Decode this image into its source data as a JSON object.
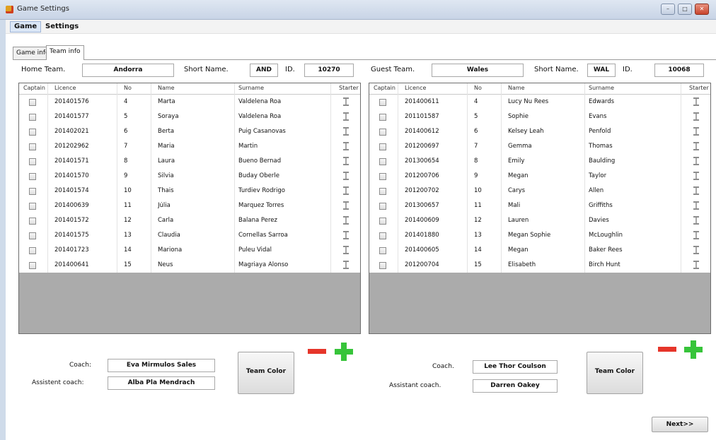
{
  "window": {
    "title": "Game Settings",
    "controls": [
      "minimize-icon",
      "maximize-icon",
      "close-icon"
    ]
  },
  "menu": [
    "Game",
    "Settings"
  ],
  "tabs": [
    "Game info",
    "Team info"
  ],
  "columns": [
    "Captain",
    "Licence",
    "No",
    "Name",
    "Surname",
    "Starter"
  ],
  "home": {
    "team_label": "Home Team.",
    "team": "Andorra",
    "short_label": "Short Name.",
    "short": "AND",
    "id_label": "ID.",
    "id": "10270",
    "players": [
      {
        "licence": "201401576",
        "no": "4",
        "name": "Marta",
        "surname": "Valdelena Roa"
      },
      {
        "licence": "201401577",
        "no": "5",
        "name": "Soraya",
        "surname": "Valdelena Roa"
      },
      {
        "licence": "201402021",
        "no": "6",
        "name": "Berta",
        "surname": "Puig Casanovas"
      },
      {
        "licence": "201202962",
        "no": "7",
        "name": "Maria",
        "surname": "Martin"
      },
      {
        "licence": "201401571",
        "no": "8",
        "name": "Laura",
        "surname": "Bueno Bernad"
      },
      {
        "licence": "201401570",
        "no": "9",
        "name": "Silvia",
        "surname": "Buday Oberle"
      },
      {
        "licence": "201401574",
        "no": "10",
        "name": "Thais",
        "surname": "Turdiev Rodrigo"
      },
      {
        "licence": "201400639",
        "no": "11",
        "name": "Júlia",
        "surname": "Marquez Torres"
      },
      {
        "licence": "201401572",
        "no": "12",
        "name": "Carla",
        "surname": "Balana Perez"
      },
      {
        "licence": "201401575",
        "no": "13",
        "name": "Claudia",
        "surname": "Cornellas Sarroa"
      },
      {
        "licence": "201401723",
        "no": "14",
        "name": "Mariona",
        "surname": "Puleu Vidal"
      },
      {
        "licence": "201400641",
        "no": "15",
        "name": "Neus",
        "surname": "Magriaya Alonso"
      }
    ],
    "coach_label": "Coach:",
    "coach": "Eva Mirmulos Sales",
    "assistant_label": "Assistent coach:",
    "assistant": "Alba Pla Mendrach",
    "color_button": "Team Color"
  },
  "guest": {
    "team_label": "Guest Team.",
    "team": "Wales",
    "short_label": "Short Name.",
    "short": "WAL",
    "id_label": "ID.",
    "id": "10068",
    "players": [
      {
        "licence": "201400611",
        "no": "4",
        "name": "Lucy Nu Rees",
        "surname": "Edwards"
      },
      {
        "licence": "201101587",
        "no": "5",
        "name": "Sophie",
        "surname": "Evans"
      },
      {
        "licence": "201400612",
        "no": "6",
        "name": "Kelsey Leah",
        "surname": "Penfold"
      },
      {
        "licence": "201200697",
        "no": "7",
        "name": "Gemma",
        "surname": "Thomas"
      },
      {
        "licence": "201300654",
        "no": "8",
        "name": "Emily",
        "surname": "Baulding"
      },
      {
        "licence": "201200706",
        "no": "9",
        "name": "Megan",
        "surname": "Taylor"
      },
      {
        "licence": "201200702",
        "no": "10",
        "name": "Carys",
        "surname": "Allen"
      },
      {
        "licence": "201300657",
        "no": "11",
        "name": "Mali",
        "surname": "Griffiths"
      },
      {
        "licence": "201400609",
        "no": "12",
        "name": "Lauren",
        "surname": "Davies"
      },
      {
        "licence": "201401880",
        "no": "13",
        "name": "Megan Sophie",
        "surname": "McLoughlin"
      },
      {
        "licence": "201400605",
        "no": "14",
        "name": "Megan",
        "surname": "Baker Rees"
      },
      {
        "licence": "201200704",
        "no": "15",
        "name": "Elisabeth",
        "surname": "Birch Hunt"
      }
    ],
    "coach_label": "Coach.",
    "coach": "Lee Thor Coulson",
    "assistant_label": "Assistant coach.",
    "assistant": "Darren Oakey",
    "color_button": "Team Color"
  },
  "next_button": "Next>>",
  "colors": {
    "minus": "#e6352a",
    "plus": "#37c43a",
    "grid_empty": "#ababab"
  }
}
